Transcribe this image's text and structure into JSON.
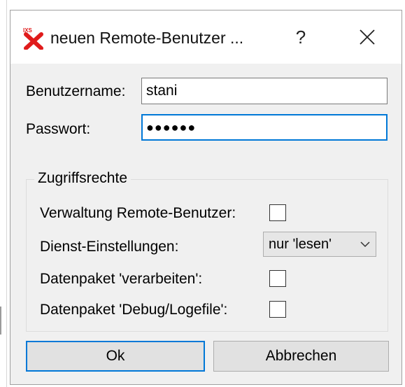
{
  "window": {
    "title": "neuen Remote-Benutzer ...",
    "help_label": "?",
    "close_icon": "close-icon",
    "app_icon": "app-logo-icon",
    "accent_color": "#0078d7",
    "logo_color": "#e01b1b"
  },
  "form": {
    "username_label": "Benutzername:",
    "username_value": "stani",
    "password_label": "Passwort:",
    "password_value": "●●●●●●"
  },
  "permissions": {
    "group_title": "Zugriffsrechte",
    "items": [
      {
        "label": "Verwaltung Remote-Benutzer:",
        "type": "checkbox",
        "checked": false
      },
      {
        "label": "Dienst-Einstellungen:",
        "type": "select",
        "value": "nur 'lesen'"
      },
      {
        "label": "Datenpaket 'verarbeiten':",
        "type": "checkbox",
        "checked": false
      },
      {
        "label": "Datenpaket 'Debug/Logefile':",
        "type": "checkbox",
        "checked": false
      }
    ]
  },
  "buttons": {
    "ok_label": "Ok",
    "cancel_label": "Abbrechen"
  }
}
